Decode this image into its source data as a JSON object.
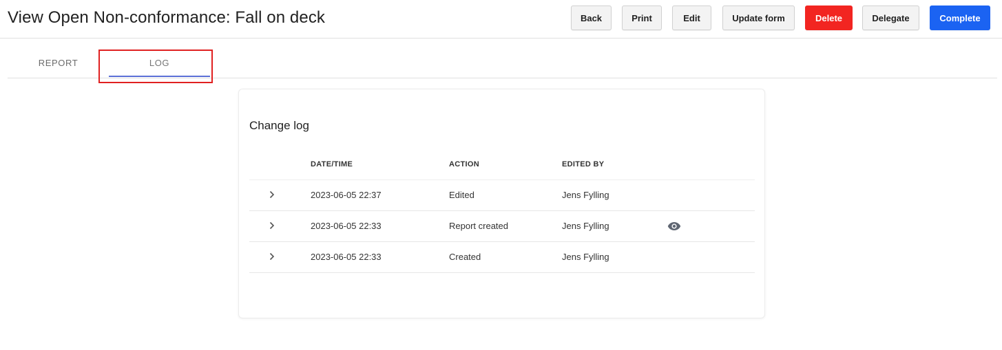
{
  "header": {
    "title": "View Open Non-conformance: Fall on deck",
    "buttons": {
      "back": "Back",
      "print": "Print",
      "edit": "Edit",
      "update_form": "Update form",
      "delete": "Delete",
      "delegate": "Delegate",
      "complete": "Complete"
    }
  },
  "tabs": {
    "report": "REPORT",
    "log": "LOG",
    "active": "log"
  },
  "change_log": {
    "title": "Change log",
    "columns": {
      "date_time": "DATE/TIME",
      "action": "ACTION",
      "edited_by": "EDITED BY"
    },
    "rows": [
      {
        "date_time": "2023-06-05 22:37",
        "action": "Edited",
        "edited_by": "Jens Fylling",
        "has_view": false
      },
      {
        "date_time": "2023-06-05 22:33",
        "action": "Report created",
        "edited_by": "Jens Fylling",
        "has_view": true
      },
      {
        "date_time": "2023-06-05 22:33",
        "action": "Created",
        "edited_by": "Jens Fylling",
        "has_view": false
      }
    ]
  },
  "icons": {
    "expand": "chevron-right-icon",
    "view": "eye-icon"
  },
  "colors": {
    "delete": "#f22521",
    "complete": "#1b63f2",
    "active_tab_underline": "#5b6fd6",
    "highlight": "#e02020"
  }
}
